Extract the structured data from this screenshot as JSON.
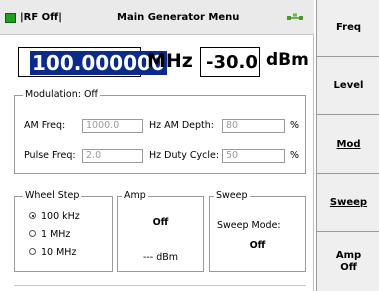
{
  "header": {
    "rf_status": "|RF Off|",
    "title": "Main Generator Menu",
    "rf_led_color": "#20a020",
    "network_icon": "network-icon"
  },
  "frequency": {
    "value": "100.000000",
    "unit": "MHz"
  },
  "level": {
    "value": "-30.0",
    "unit": "dBm"
  },
  "modulation": {
    "title": "Modulation: Off",
    "am_freq_label": "AM Freq:",
    "am_freq_value": "1000.0",
    "am_depth_label": "Hz AM Depth:",
    "am_depth_value": "80",
    "am_depth_unit": "%",
    "pulse_freq_label": "Pulse Freq:",
    "pulse_freq_value": "2.0",
    "duty_cycle_label": "Hz Duty Cycle:",
    "duty_cycle_value": "50",
    "duty_cycle_unit": "%"
  },
  "wheel_step": {
    "title": "Wheel Step",
    "options": [
      "100 kHz",
      "1 MHz",
      "10 MHz"
    ],
    "selected": "100 kHz"
  },
  "amp": {
    "title": "Amp",
    "state": "Off",
    "level": "--- dBm"
  },
  "sweep": {
    "title": "Sweep",
    "mode_label": "Sweep Mode:",
    "mode_value": "Off"
  },
  "softkeys": [
    {
      "label": "Freq",
      "label2": ""
    },
    {
      "label": "Level",
      "label2": ""
    },
    {
      "label": "Mod",
      "label2": ""
    },
    {
      "label": "Sweep",
      "label2": ""
    },
    {
      "label": "Amp",
      "label2": "Off"
    }
  ],
  "colors": {
    "selection": "#0c2a8a",
    "panel_bg": "#efefef"
  }
}
